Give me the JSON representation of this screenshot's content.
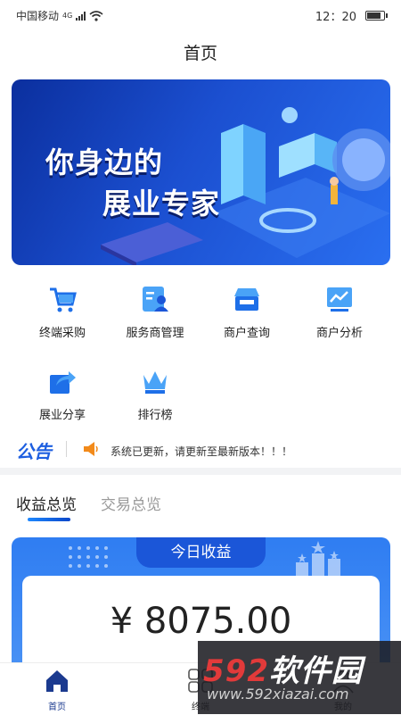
{
  "status_bar": {
    "carrier": "中国移动",
    "network": "4G",
    "time": "12：20"
  },
  "page": {
    "title": "首页"
  },
  "banner": {
    "line1": "你身边的",
    "line2": "展业专家"
  },
  "grid": [
    {
      "label": "终端采购",
      "icon": "cart-icon"
    },
    {
      "label": "服务商管理",
      "icon": "person-card-icon"
    },
    {
      "label": "商户查询",
      "icon": "store-icon"
    },
    {
      "label": "商户分析",
      "icon": "chart-icon"
    },
    {
      "label": "展业分享",
      "icon": "share-icon"
    },
    {
      "label": "排行榜",
      "icon": "crown-icon"
    }
  ],
  "notice": {
    "logo": "公告",
    "text": "系统已更新，请更新至最新版本！！！"
  },
  "tabs": [
    {
      "label": "收益总览"
    },
    {
      "label": "交易总览"
    }
  ],
  "earnings": {
    "title": "今日收益",
    "amount": "¥ 8075.00"
  },
  "bottom_nav": [
    {
      "label": "首页"
    },
    {
      "label": "终端"
    },
    {
      "label": "我的"
    }
  ],
  "watermark": {
    "logo_num": "592",
    "logo_text": "软件园",
    "url": "www.592xiazai.com"
  },
  "colors": {
    "primary": "#1b56d8",
    "accent": "#1e88ff",
    "orange": "#f28a1a"
  }
}
